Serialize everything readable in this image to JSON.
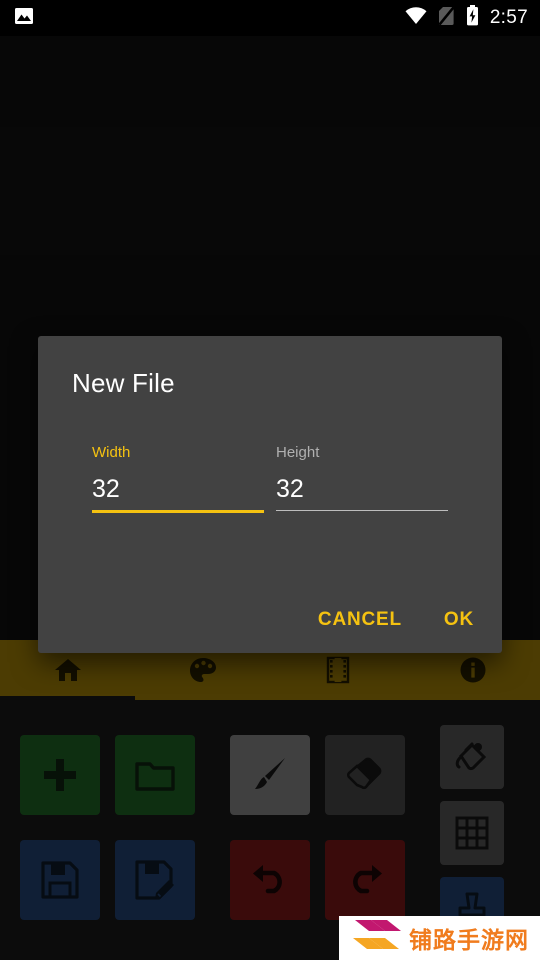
{
  "statusbar": {
    "notification_icon": "image-icon",
    "wifi_icon": "wifi-icon",
    "sim_icon": "no-sim-icon",
    "battery_icon": "battery-charging-icon",
    "time": "2:57"
  },
  "tabbar": {
    "background_color": "#8a6d06",
    "selected_index": 0,
    "tabs": [
      {
        "name": "home",
        "icon": "home-icon",
        "label": "Home"
      },
      {
        "name": "palette",
        "icon": "palette-icon",
        "label": "Palette"
      },
      {
        "name": "frames",
        "icon": "film-icon",
        "label": "Frames"
      },
      {
        "name": "info",
        "icon": "info-icon",
        "label": "Info"
      }
    ]
  },
  "tools": [
    {
      "name": "new-file",
      "icon": "plus-icon",
      "color": "#1b5620",
      "row": 0,
      "col": 0
    },
    {
      "name": "open-file",
      "icon": "folder-icon",
      "color": "#1b5620",
      "row": 0,
      "col": 1
    },
    {
      "name": "brush",
      "icon": "brush-icon",
      "color": "#757575",
      "row": 0,
      "col": 2
    },
    {
      "name": "eraser",
      "icon": "eraser-icon",
      "color": "#3e3e3e",
      "row": 0,
      "col": 3
    },
    {
      "name": "save",
      "icon": "floppy-icon",
      "color": "#1e3a63",
      "row": 1,
      "col": 0
    },
    {
      "name": "save-as",
      "icon": "floppy-edit-icon",
      "color": "#1e3a63",
      "row": 1,
      "col": 1
    },
    {
      "name": "undo",
      "icon": "undo-icon",
      "color": "#6b1515",
      "row": 1,
      "col": 2
    },
    {
      "name": "redo",
      "icon": "redo-icon",
      "color": "#6b1515",
      "row": 1,
      "col": 3
    }
  ],
  "side_tools": [
    {
      "name": "fill-bucket",
      "icon": "paint-bucket-icon",
      "color": "#4a4a4a"
    },
    {
      "name": "grid-toggle",
      "icon": "grid-icon",
      "color": "#4a4a4a"
    },
    {
      "name": "stamp",
      "icon": "stamp-icon",
      "color": "#1e3a63"
    }
  ],
  "dialog": {
    "title": "New File",
    "accent_color": "#f5c211",
    "background_color": "#424242",
    "fields": [
      {
        "name": "width",
        "label": "Width",
        "value": "32",
        "placeholder": "32",
        "focused": true
      },
      {
        "name": "height",
        "label": "Height",
        "value": "32",
        "placeholder": "32",
        "focused": false
      }
    ],
    "cancel_label": "CANCEL",
    "ok_label": "OK"
  },
  "watermark": {
    "text": "铺路手游网",
    "chevron_top_color": "#c2186f",
    "chevron_bottom_color": "#f5a623",
    "text_color": "#f07c1e"
  }
}
